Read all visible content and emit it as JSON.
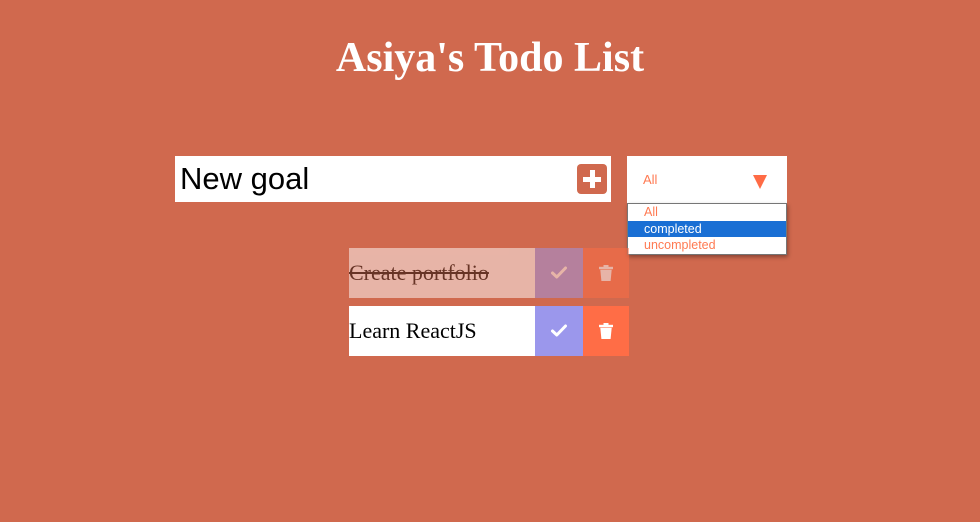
{
  "header": {
    "title": "Asiya's Todo List"
  },
  "form": {
    "input_value": "New goal",
    "add_icon": "plus-square-icon",
    "filter": {
      "selected": "All",
      "options": [
        "All",
        "completed",
        "uncompleted"
      ],
      "highlighted_option": "completed"
    }
  },
  "todos": [
    {
      "text": "Create portfolio",
      "completed": true
    },
    {
      "text": "Learn ReactJS",
      "completed": false
    }
  ],
  "colors": {
    "background": "#d0694e",
    "accent_check": "#9b97ec",
    "accent_trash": "#ff6d46",
    "option_highlight": "#1a6fd4",
    "option_text": "#ff7a52"
  }
}
